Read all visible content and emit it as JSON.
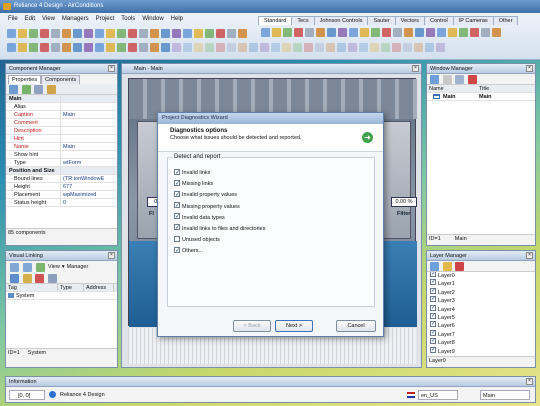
{
  "app": {
    "title": "Reliance 4 Design - AirConditions"
  },
  "menu": [
    "File",
    "Edit",
    "View",
    "Managers",
    "Project",
    "Tools",
    "Window",
    "Help"
  ],
  "palette_tabs": [
    "Standard",
    "Tecs",
    "Johnson Controls",
    "Sauter",
    "Vectors",
    "Control",
    "IP Cameras",
    "Other"
  ],
  "component_manager": {
    "title": "Component Manager",
    "tabs": [
      "Properties",
      "Components"
    ],
    "rows": [
      {
        "name": "Main",
        "value": "",
        "group": true
      },
      {
        "name": "Alias",
        "value": ""
      },
      {
        "name": "Caption",
        "value": "Main",
        "red": true
      },
      {
        "name": "Comment",
        "value": "",
        "red": true
      },
      {
        "name": "Description",
        "value": "",
        "red": true
      },
      {
        "name": "Hint",
        "value": "",
        "red": true
      },
      {
        "name": "Name",
        "value": "Main",
        "red": true
      },
      {
        "name": "Show hint",
        "value": ""
      },
      {
        "name": "Type",
        "value": "wtForm"
      },
      {
        "name": "Position and Size",
        "value": "",
        "group": true
      },
      {
        "name": "Bound lines",
        "value": "(TR:ionWindowE"
      },
      {
        "name": "Height",
        "value": "677"
      },
      {
        "name": "Placement",
        "value": "wpMaximized"
      },
      {
        "name": "Status height",
        "value": "0"
      }
    ],
    "footer": "85 components"
  },
  "visual_linking": {
    "title": "Visual Linking",
    "view_label": "View",
    "manager_label": "Manager",
    "columns": [
      "Tag",
      "Type",
      "Address"
    ],
    "rows": [
      {
        "tag": "System",
        "type": "",
        "address": ""
      }
    ],
    "footer_id": "ID=1",
    "footer_name": "System"
  },
  "main_window": {
    "title": "Main - Main",
    "readouts": [
      "0.0",
      "0.00 %"
    ],
    "labels": [
      "Fl",
      "Filter"
    ]
  },
  "window_manager": {
    "title": "Window Manager",
    "columns": [
      "Name",
      "Title"
    ],
    "rows": [
      {
        "name": "Main",
        "title": "Main"
      }
    ],
    "footer_id": "ID=1",
    "footer_name": "Main"
  },
  "layer_manager": {
    "title": "Layer Manager",
    "layers": [
      "Layer0",
      "Layer1",
      "Layer2",
      "Layer3",
      "Layer4",
      "Layer5",
      "Layer6",
      "Layer7",
      "Layer8",
      "Layer9"
    ],
    "footer": "Layer0"
  },
  "dialog": {
    "title": "Project Diagnostics Wizard",
    "heading": "Diagnostics options",
    "subheading": "Choose what issues should be detected and reported.",
    "group_label": "Detect and report",
    "options": [
      {
        "label": "Invalid links",
        "checked": true
      },
      {
        "label": "Missing links",
        "checked": true
      },
      {
        "label": "Invalid property values",
        "checked": true
      },
      {
        "label": "Missing property values",
        "checked": true
      },
      {
        "label": "Invalid data types",
        "checked": true
      },
      {
        "label": "Invalid links to files and directories",
        "checked": true
      },
      {
        "label": "Unused objects",
        "checked": false
      },
      {
        "label": "Others...",
        "checked": true
      }
    ],
    "back_label": "< Back",
    "next_label": "Next >",
    "cancel_label": "Cancel"
  },
  "info": {
    "title": "Information",
    "coords": "[0, 0]",
    "product": "Reliance 4 Design",
    "locale": "en_US",
    "window": "Main"
  }
}
